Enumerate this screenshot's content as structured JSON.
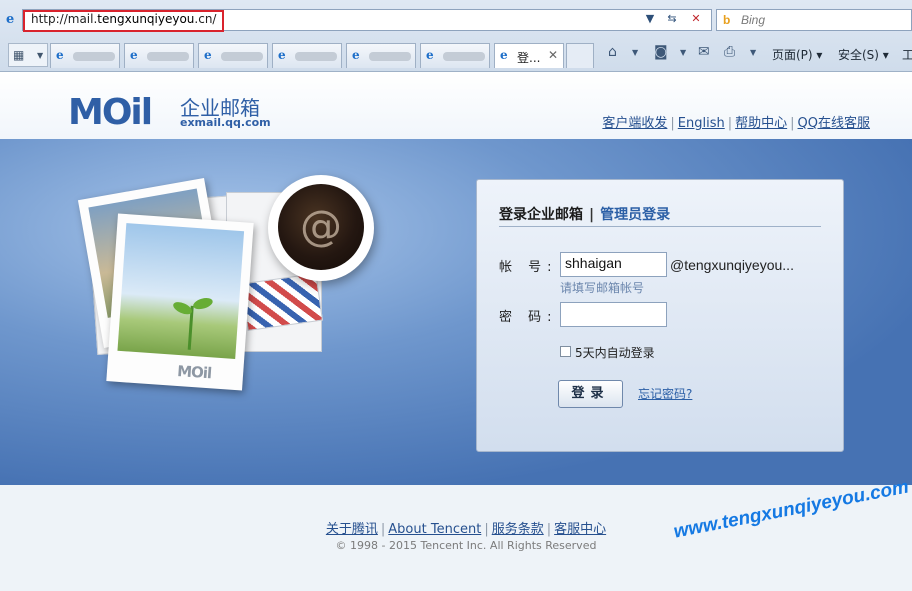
{
  "browser": {
    "address_url_prefix": "http://mail.",
    "address_url_domain": "tengxunqiyeyou",
    "address_url_suffix": ".cn/",
    "search_placeholder": "Bing",
    "tabs": [
      {
        "label": ""
      },
      {
        "label": ""
      },
      {
        "label": ""
      },
      {
        "label": ""
      },
      {
        "label": ""
      },
      {
        "label": ""
      },
      {
        "label": "登..."
      }
    ],
    "commands": {
      "page": "页面(P)",
      "safety": "安全(S)",
      "tools": "工"
    }
  },
  "header": {
    "logo_text": "MOil",
    "logo_cn": "企业邮箱",
    "logo_domain": "exmail.qq.com",
    "links": [
      "客户端收发",
      "English",
      "帮助中心",
      "QQ在线客服"
    ]
  },
  "illustration": {
    "cup_symbol": "@",
    "photo_mark": "MOil"
  },
  "login": {
    "title": "登录企业邮箱",
    "admin_link": "管理员登录",
    "account_label": "帐  号:",
    "account_value": "shhaigan",
    "domain_suffix": "@tengxunqiyeyou...",
    "account_hint": "请填写邮箱帐号",
    "password_label": "密  码:",
    "password_value": "",
    "remember_label": "5天内自动登录",
    "remember_checked": false,
    "submit_label": "登录",
    "forgot_link": "忘记密码?"
  },
  "footer": {
    "links": [
      "关于腾讯",
      "About Tencent",
      "服务条款",
      "客服中心"
    ],
    "copyright": "© 1998 - 2015 Tencent Inc. All Rights Reserved",
    "watermark": "www.tengxunqiyeyou.com"
  }
}
